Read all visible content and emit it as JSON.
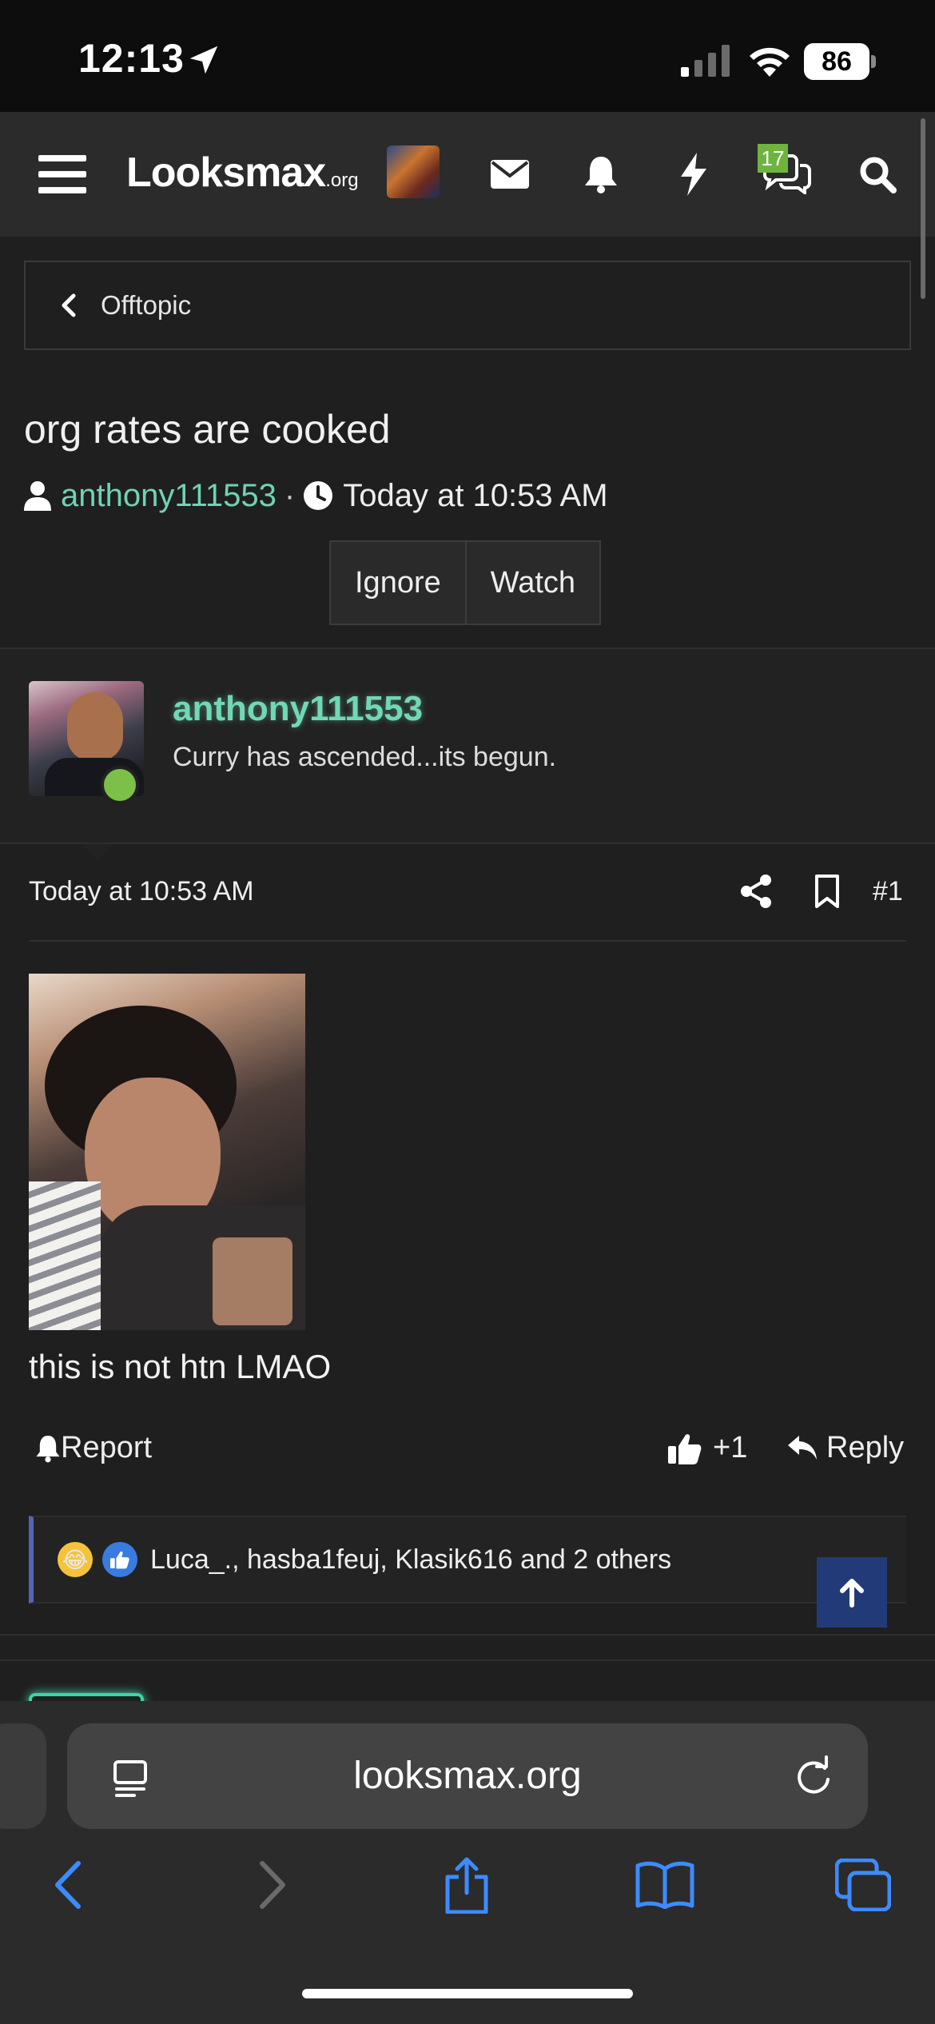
{
  "status_bar": {
    "time": "12:13",
    "battery": "86"
  },
  "header": {
    "logo": "Looksmax",
    "logo_suffix": ".org",
    "conversations_badge": "17"
  },
  "breadcrumb": {
    "label": "Offtopic"
  },
  "thread": {
    "title": "org rates are cooked",
    "author": "anthony111553",
    "date": "Today at 10:53 AM",
    "ignore_label": "Ignore",
    "watch_label": "Watch"
  },
  "post": {
    "username": "anthony111553",
    "user_title": "Curry has ascended...its begun.",
    "date": "Today at 10:53 AM",
    "number": "#1",
    "text": "this is not htn LMAO",
    "report_label": "Report",
    "like_count": "+1",
    "reply_label": "Reply",
    "reactions_text": "Luca_., hasba1feuj, Klasik616 and 2 others"
  },
  "browser": {
    "url": "looksmax.org"
  },
  "colors": {
    "accent_username": "#72d7b4",
    "online_dot": "#7cc04a",
    "badge_green": "#6fb43f",
    "reaction_border": "#5565b8",
    "scroll_top_bg": "#233a78",
    "safari_blue": "#3d8bff"
  },
  "icons": {
    "menu": "hamburger-icon",
    "mail": "envelope-icon",
    "alerts": "bell-icon",
    "whats_new": "lightning-icon",
    "conversations": "chat-bubbles-icon",
    "search": "search-icon"
  }
}
